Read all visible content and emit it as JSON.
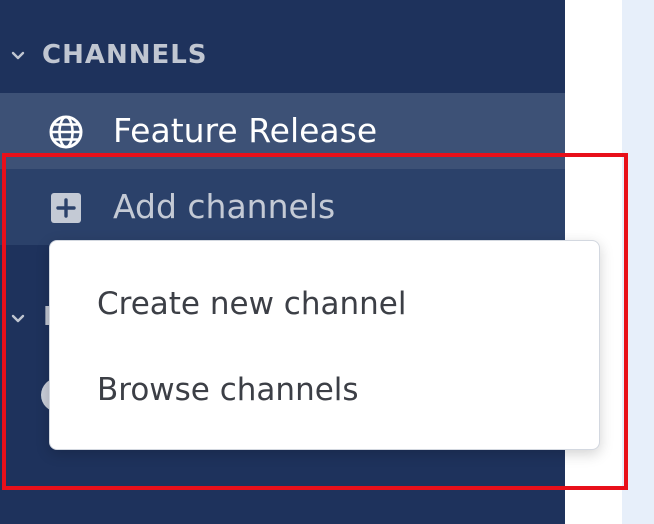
{
  "sidebar": {
    "channels_section": {
      "title": "CHANNELS",
      "chevron_icon": "chevron-down-icon"
    },
    "channels": [
      {
        "label": "Feature Release",
        "icon": "globe-icon",
        "active": true
      }
    ],
    "add_channels": {
      "label": "Add channels",
      "icon": "plus-square-icon"
    },
    "second_section": {
      "title_visible": "D",
      "chevron_icon": "chevron-down-icon"
    }
  },
  "dropdown": {
    "items": [
      {
        "label": "Create new channel"
      },
      {
        "label": "Browse channels"
      }
    ]
  },
  "colors": {
    "sidebar_bg": "#1e325c",
    "active_item_bg": "#3d5176",
    "add_item_bg": "#2b416a",
    "highlight_border": "#e8101a",
    "content_bg": "#e7effa"
  }
}
